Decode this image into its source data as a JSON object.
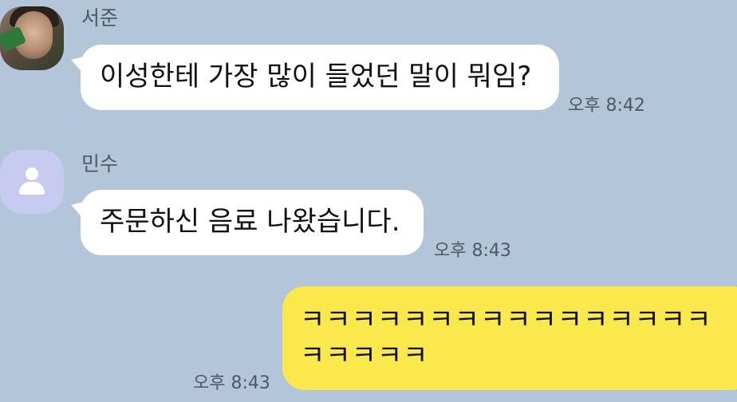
{
  "messages": [
    {
      "sender": "서준",
      "avatar_icon": "profile-photo",
      "text": "이성한테 가장 많이 들었던 말이 뭐임?",
      "time": "오후 8:42"
    },
    {
      "sender": "민수",
      "avatar_icon": "default-person-icon",
      "text": "주문하신 음료 나왔습니다.",
      "time": "오후 8:43"
    },
    {
      "sender": "me",
      "text": "ㅋㅋㅋㅋㅋㅋㅋㅋㅋㅋㅋㅋㅋㅋㅋㅋㅋㅋㅋㅋㅋ",
      "time": "오후 8:43"
    }
  ],
  "colors": {
    "background": "#b2c5d9",
    "incoming_bubble": "#ffffff",
    "outgoing_bubble": "#fae84c",
    "default_avatar": "#c6cbef",
    "meta_text": "#4d5966"
  }
}
